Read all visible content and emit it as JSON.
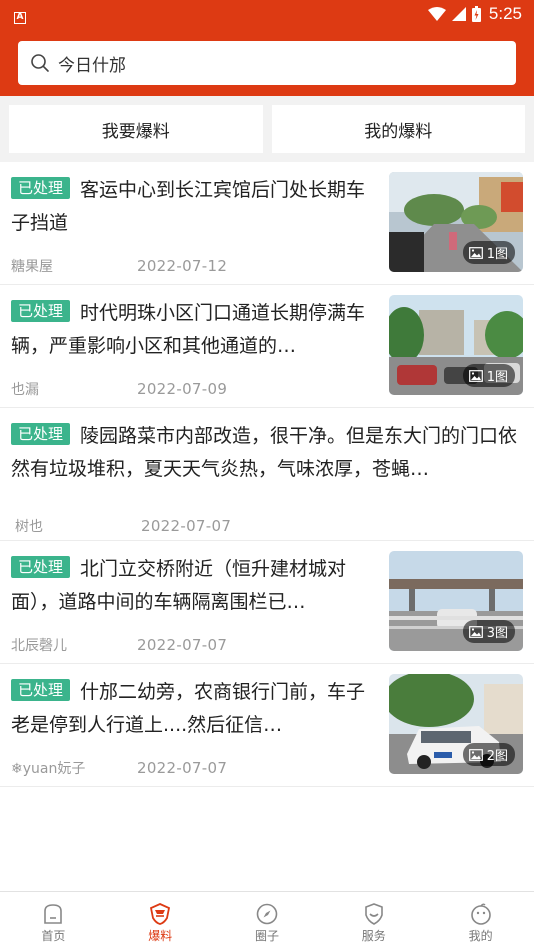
{
  "status_bar": {
    "time": "5:25",
    "notification_icon": "A"
  },
  "search": {
    "placeholder": "今日什邡",
    "icon": "search-icon"
  },
  "tabs": [
    {
      "label": "我要爆料"
    },
    {
      "label": "我的爆料"
    }
  ],
  "feed": [
    {
      "badge": "已处理",
      "title": "客运中心到长江宾馆后门处长期车子挡道",
      "author": "糖果屋",
      "date": "2022-07-12",
      "image_count": "1图"
    },
    {
      "badge": "已处理",
      "title": "时代明珠小区门口通道长期停满车辆，严重影响小区和其他通道的…",
      "author": "也漏",
      "date": "2022-07-09",
      "image_count": "1图"
    },
    {
      "badge": "已处理",
      "title": "陵园路菜市内部改造，很干净。但是东大门的门口依然有垃圾堆积，夏天天气炎热，气味浓厚，苍蝇…",
      "author": "树也",
      "date": "2022-07-07"
    },
    {
      "badge": "已处理",
      "title": "北门立交桥附近（恒升建材城对面），道路中间的车辆隔离围栏已…",
      "author": "北辰磬儿",
      "date": "2022-07-07",
      "image_count": "3图"
    },
    {
      "badge": "已处理",
      "title": "什邡二幼旁，农商银行门前，车子老是停到人行道上....然后征信…",
      "author": "❄yuan妧子",
      "date": "2022-07-07",
      "image_count": "2图"
    }
  ],
  "bottom_nav": [
    {
      "label": "首页",
      "icon": "home-icon"
    },
    {
      "label": "爆料",
      "icon": "report-shield-icon",
      "active": true
    },
    {
      "label": "圈子",
      "icon": "compass-icon"
    },
    {
      "label": "服务",
      "icon": "service-shield-icon"
    },
    {
      "label": "我的",
      "icon": "profile-face-icon"
    }
  ],
  "colors": {
    "brand": "#dd3a13",
    "badge": "#3bb48c",
    "meta": "#9a9a9a"
  }
}
